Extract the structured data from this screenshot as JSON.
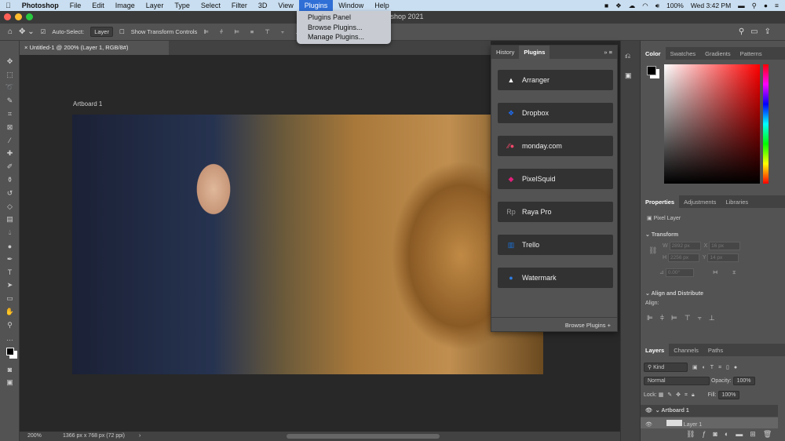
{
  "menubar": {
    "apple": "",
    "app": "Photoshop",
    "items": [
      "File",
      "Edit",
      "Image",
      "Layer",
      "Type",
      "Select",
      "Filter",
      "3D",
      "View",
      "Plugins",
      "Window",
      "Help"
    ],
    "active": "Plugins",
    "battery": "100%",
    "clock": "Wed 3:42 PM"
  },
  "plugins_menu": {
    "items": [
      "Plugins Panel",
      "Browse Plugins...",
      "Manage Plugins..."
    ]
  },
  "window": {
    "title": "Adobe Photoshop 2021",
    "title_visible": "toshop 2021"
  },
  "options": {
    "auto_select_label": "Auto-Select:",
    "auto_select_checked": true,
    "auto_select_value": "Layer",
    "show_transform_label": "Show Transform Controls",
    "show_transform_checked": false
  },
  "document": {
    "tab": "Untitled-1 @ 200% (Layer 1, RGB/8#)",
    "artboard_label": "Artboard 1"
  },
  "plugins_panel": {
    "tabs": [
      "History",
      "Plugins"
    ],
    "active_tab": "Plugins",
    "items": [
      {
        "name": "Arranger",
        "icon": "triangle-icon",
        "color": "#ffffff"
      },
      {
        "name": "Dropbox",
        "icon": "dropbox-icon",
        "color": "#1e6cf0"
      },
      {
        "name": "monday.com",
        "icon": "monday-icon",
        "color": "#f5486b"
      },
      {
        "name": "PixelSquid",
        "icon": "pixelsquid-icon",
        "color": "#e0207a"
      },
      {
        "name": "Raya Pro",
        "icon": "rp-icon",
        "color": "#999999"
      },
      {
        "name": "Trello",
        "icon": "trello-icon",
        "color": "#1a72d8"
      },
      {
        "name": "Watermark",
        "icon": "watermark-icon",
        "color": "#2f7de1"
      }
    ],
    "footer": "Browse Plugins"
  },
  "color_panel": {
    "tabs": [
      "Color",
      "Swatches",
      "Gradients",
      "Patterns"
    ],
    "active_tab": "Color",
    "hue_color": "#ff0000"
  },
  "properties_panel": {
    "tabs": [
      "Properties",
      "Adjustments",
      "Libraries"
    ],
    "active_tab": "Properties",
    "layer_type": "Pixel Layer",
    "transform": "Transform",
    "w": "2892 px",
    "h": "2256 px",
    "x": "16 px",
    "y": "14 px",
    "angle": "0.00°",
    "align_section": "Align and Distribute",
    "align_label": "Align:"
  },
  "layers_panel": {
    "tabs": [
      "Layers",
      "Channels",
      "Paths"
    ],
    "active_tab": "Layers",
    "filter": "Kind",
    "blend_mode": "Normal",
    "opacity_label": "Opacity:",
    "opacity": "100%",
    "lock_label": "Lock:",
    "fill_label": "Fill:",
    "fill": "100%",
    "layers": [
      "Artboard 1",
      "Layer 1"
    ]
  },
  "status": {
    "zoom": "200%",
    "doc_info": "1366 px x 768 px (72 ppi)"
  }
}
